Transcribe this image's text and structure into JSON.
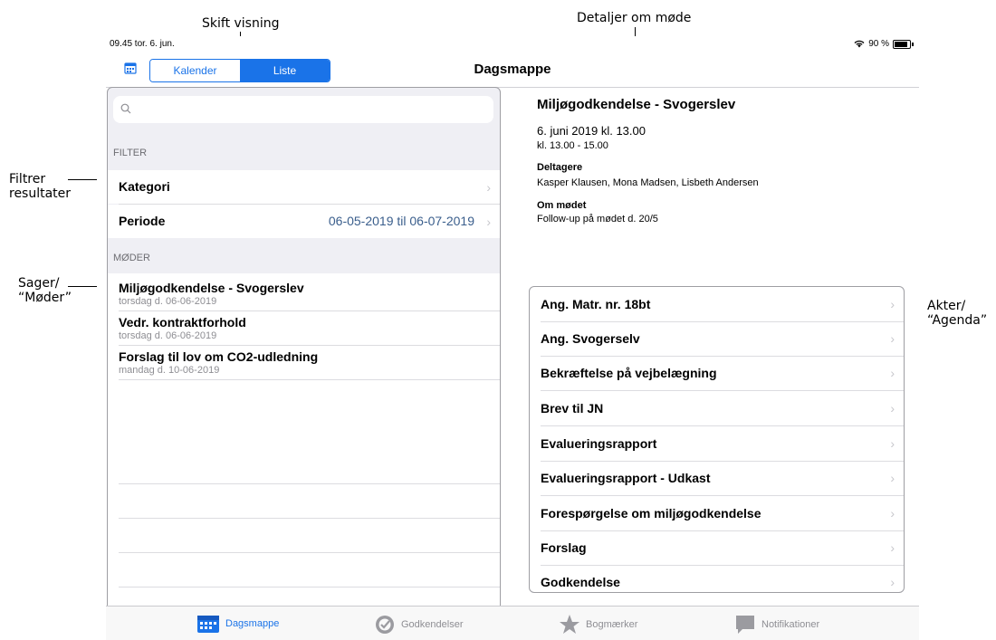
{
  "callouts": {
    "skift": "Skift visning",
    "detaljer": "Detaljer om møde",
    "filtrer_1": "Filtrer",
    "filtrer_2": "resultater",
    "sager_1": "Sager/",
    "sager_2": "“Møder”",
    "akter_1": "Akter/",
    "akter_2": "“Agenda”"
  },
  "status": {
    "time": "09.45  tor. 6. jun.",
    "battery": "90 %"
  },
  "nav": {
    "title": "Dagsmappe",
    "seg_left": "Kalender",
    "seg_right": "Liste"
  },
  "left": {
    "search_placeholder": "",
    "filter_header": "FILTER",
    "kategori": "Kategori",
    "periode": "Periode",
    "periode_value": "06-05-2019 til 06-07-2019",
    "meetings_header": "MØDER",
    "meetings": [
      {
        "title": "Miljøgodkendelse - Svogerslev",
        "date": "torsdag d. 06-06-2019"
      },
      {
        "title": "Vedr. kontraktforhold",
        "date": "torsdag d. 06-06-2019"
      },
      {
        "title": "Forslag til lov om CO2-udledning",
        "date": "mandag d. 10-06-2019"
      }
    ]
  },
  "detail": {
    "title": "Miljøgodkendelse - Svogerslev",
    "date": "6. juni 2019 kl. 13.00",
    "time": "kl. 13.00 - 15.00",
    "deltagere_label": "Deltagere",
    "deltagere": "Kasper Klausen, Mona Madsen, Lisbeth Andersen",
    "om_label": "Om mødet",
    "om": "Follow-up på mødet d. 20/5"
  },
  "agenda": [
    "Ang. Matr. nr. 18bt",
    "Ang. Svogerselv",
    "Bekræftelse på vejbelægning",
    "Brev til JN",
    "Evalueringsrapport",
    "Evalueringsrapport - Udkast",
    "Forespørgelse om miljøgodkendelse",
    "Forslag",
    "Godkendelse"
  ],
  "tabs": {
    "dagsmappe": "Dagsmappe",
    "godkendelser": "Godkendelser",
    "bogmaerker": "Bogmærker",
    "notifikationer": "Notifikationer"
  },
  "colors": {
    "accent": "#1a73e8",
    "chevron": "#c7c7cc",
    "inactive_tab": "#8e8e93"
  }
}
